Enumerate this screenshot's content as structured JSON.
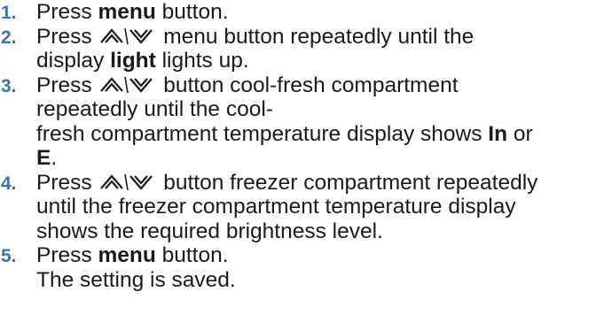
{
  "colors": {
    "number": "#3a6fc4",
    "text": "#1a1a1a"
  },
  "icons": {
    "updown": "up-down-arrow-buttons-icon"
  },
  "steps": [
    {
      "num": "1.",
      "parts": [
        "Press ",
        "menu",
        " button."
      ]
    },
    {
      "num": "2.",
      "parts": [
        "Press ",
        " menu button repeatedly until the",
        "display ",
        "light",
        " lights up."
      ]
    },
    {
      "num": "3.",
      "parts": [
        "Press ",
        " button cool-fresh compartment",
        "repeatedly until the cool-",
        "fresh compartment temperature display shows ",
        "In",
        " or",
        "E",
        "."
      ]
    },
    {
      "num": "4.",
      "parts": [
        "Press ",
        " button freezer compartment repeatedly",
        "until the freezer compartment temperature display",
        "shows the required brightness level."
      ]
    },
    {
      "num": "5.",
      "parts": [
        "Press ",
        "menu",
        " button.",
        "The setting is saved."
      ]
    }
  ]
}
